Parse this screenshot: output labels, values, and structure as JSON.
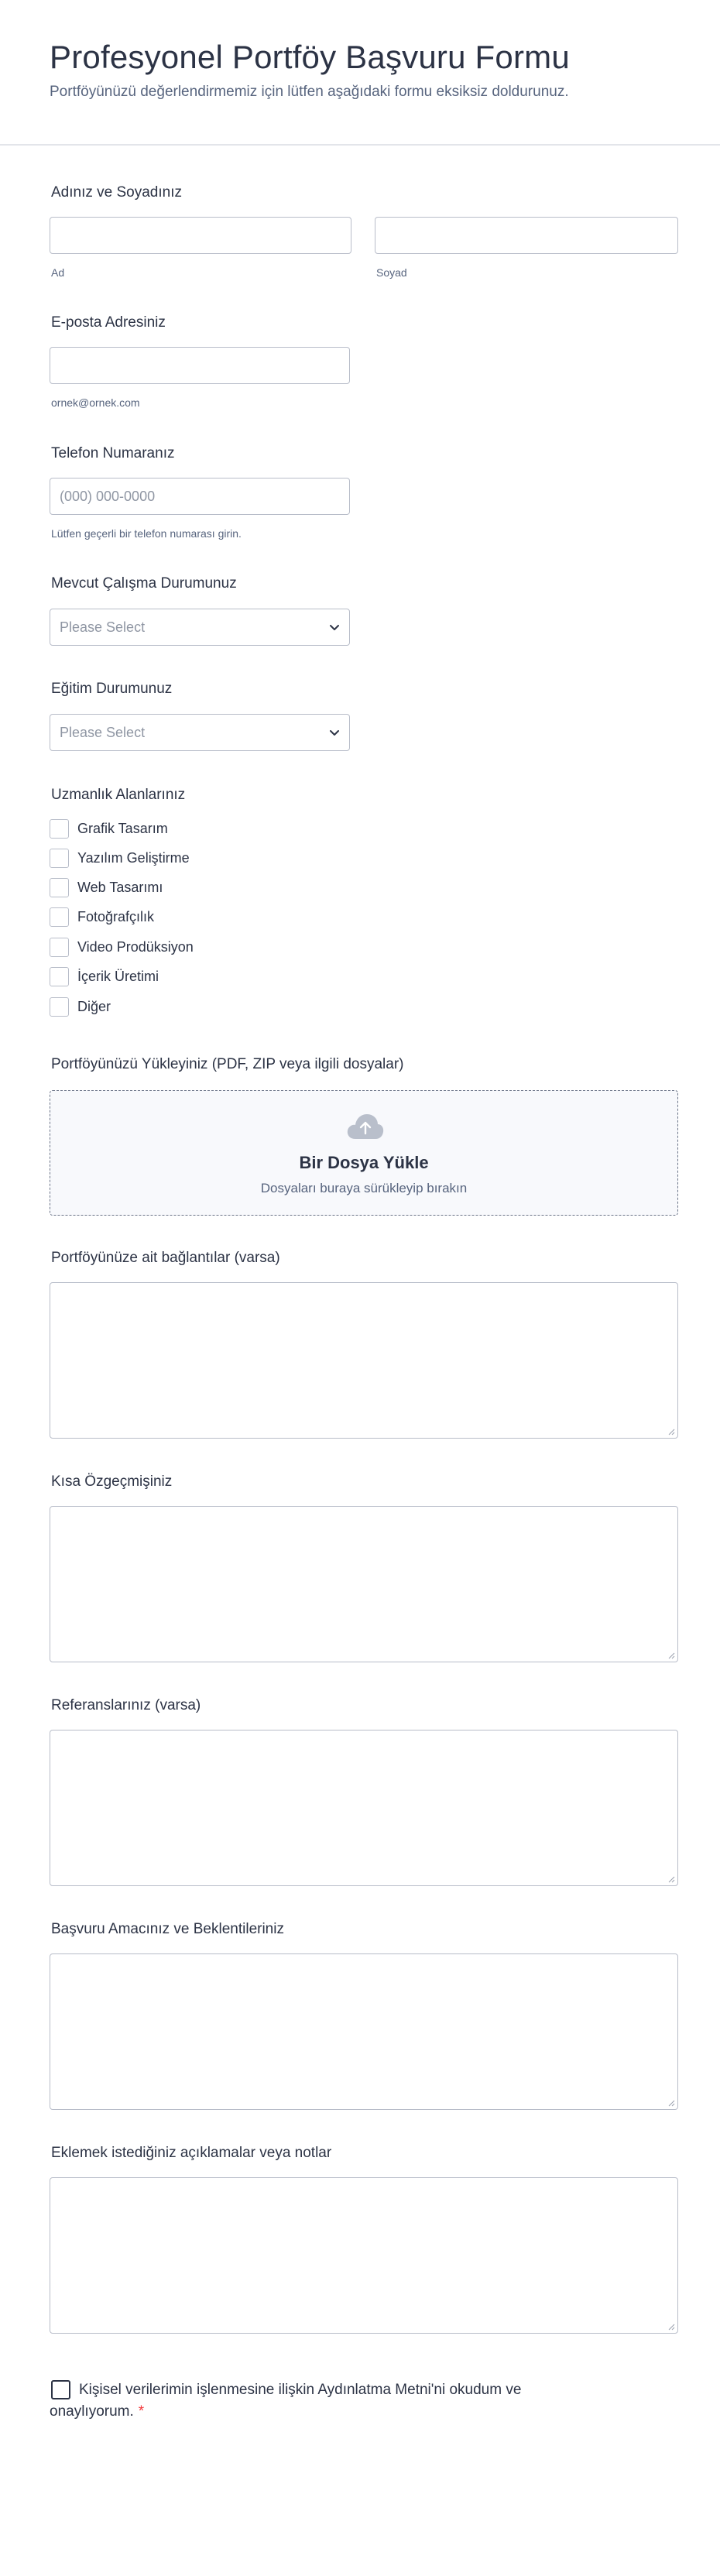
{
  "header": {
    "title": "Profesyonel Portföy Başvuru Formu",
    "subtitle": "Portföyünüzü değerlendirmemiz için lütfen aşağıdaki formu eksiksiz doldurunuz."
  },
  "name_field": {
    "label": "Adınız ve Soyadınız",
    "first_sublabel": "Ad",
    "last_sublabel": "Soyad"
  },
  "email_field": {
    "label": "E-posta Adresiniz",
    "sublabel": "ornek@ornek.com"
  },
  "phone_field": {
    "label": "Telefon Numaranız",
    "placeholder": "(000) 000-0000",
    "sublabel": "Lütfen geçerli bir telefon numarası girin."
  },
  "employment_field": {
    "label": "Mevcut Çalışma Durumunuz",
    "placeholder": "Please Select"
  },
  "education_field": {
    "label": "Eğitim Durumunuz",
    "placeholder": "Please Select"
  },
  "expertise_field": {
    "label": "Uzmanlık Alanlarınız",
    "options": [
      "Grafik Tasarım",
      "Yazılım Geliştirme",
      "Web Tasarımı",
      "Fotoğrafçılık",
      "Video Prodüksiyon",
      "İçerik Üretimi",
      "Diğer"
    ]
  },
  "upload_field": {
    "label": "Portföyünüzü Yükleyiniz (PDF, ZIP veya ilgili dosyalar)",
    "button_title": "Bir Dosya Yükle",
    "button_subtitle": "Dosyaları buraya sürükleyip bırakın"
  },
  "textareas": [
    {
      "label": "Portföyünüze ait bağlantılar (varsa)"
    },
    {
      "label": "Kısa Özgeçmişiniz"
    },
    {
      "label": "Referanslarınız (varsa)"
    },
    {
      "label": "Başvuru Amacınız ve Beklentileriniz"
    },
    {
      "label": "Eklemek istediğiniz açıklamalar veya notlar"
    }
  ],
  "consent": {
    "text": "Kişisel verilerimin işlenmesine ilişkin Aydınlatma Metni'ni okudum ve onaylıyorum.",
    "required_mark": "*"
  },
  "colors": {
    "text": "#2c3345",
    "muted": "#57647e",
    "border": "#b8bdc9",
    "required": "#f23a3c"
  }
}
